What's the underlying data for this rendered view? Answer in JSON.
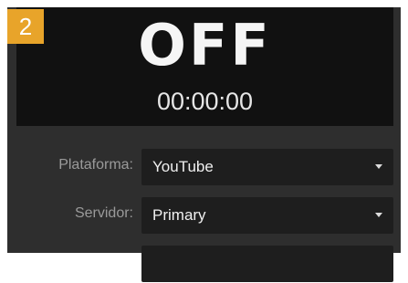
{
  "badge": {
    "number": "2",
    "color": "#e8a42a"
  },
  "stream": {
    "status": "OFF",
    "timer": "00:00:00"
  },
  "fields": {
    "platform": {
      "label": "Plataforma:",
      "value": "YouTube",
      "icon": "chevron-down-icon"
    },
    "server": {
      "label": "Servidor:",
      "value": "Primary",
      "icon": "chevron-down-icon"
    }
  }
}
